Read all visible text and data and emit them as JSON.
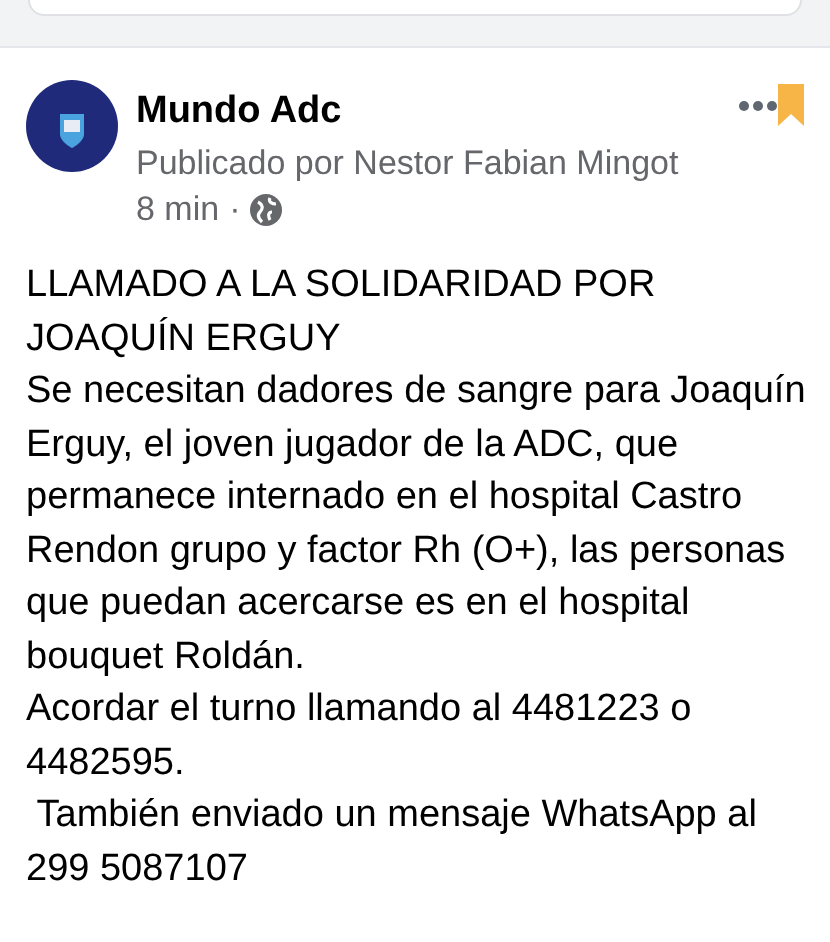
{
  "post": {
    "page_name": "Mundo Adc",
    "byline": "Publicado por Nestor Fabian Mingot",
    "time": "8 min",
    "separator": "·",
    "saved": true,
    "paragraphs": [
      "LLAMADO A LA SOLIDARIDAD POR JOAQUÍN ERGUY",
      "Se necesitan dadores de sangre para Joaquín Erguy, el joven jugador de la ADC, que permanece internado en el hospital Castro Rendon grupo y factor Rh (O+), las personas que puedan acercarse es en el hospital bouquet Roldán.",
      "Acordar el turno llamando al 4481223 o 4482595.",
      " También enviado un mensaje WhatsApp al 299 5087107"
    ]
  }
}
